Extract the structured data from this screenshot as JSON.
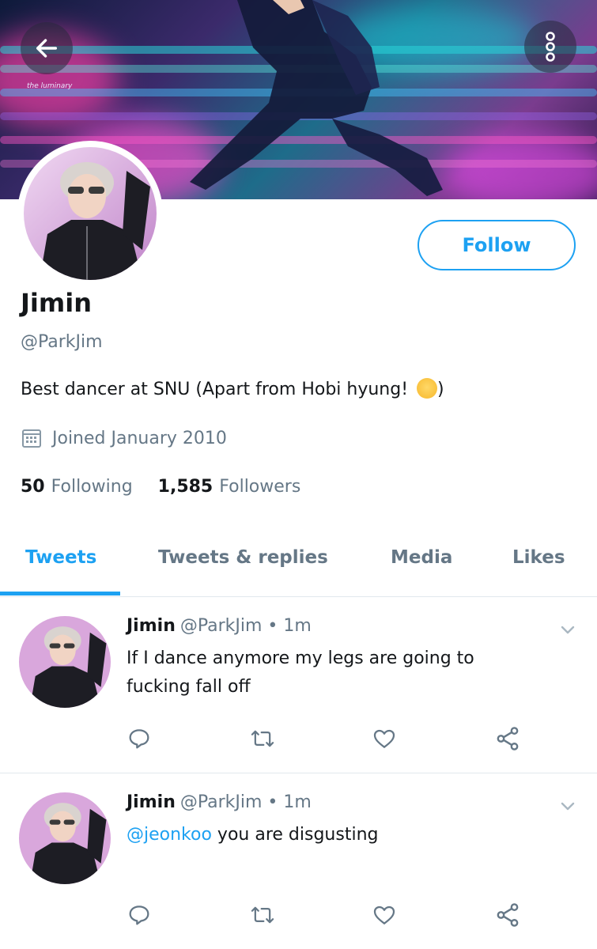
{
  "header": {
    "banner_credit": "the luminary",
    "back_icon": "arrow-left-icon",
    "more_icon": "more-vertical-icon"
  },
  "profile": {
    "name": "Jimin",
    "handle": "@ParkJim",
    "bio": "Best dancer at SNU (Apart from Hobi hyung! ",
    "bio_end": ")",
    "joined": "Joined January 2010",
    "following_count": "50",
    "following_label": "Following",
    "followers_count": "1,585",
    "followers_label": "Followers",
    "follow_label": "Follow"
  },
  "tabs": [
    {
      "label": "Tweets",
      "active": true
    },
    {
      "label": "Tweets & replies",
      "active": false
    },
    {
      "label": "Media",
      "active": false
    },
    {
      "label": "Likes",
      "active": false
    }
  ],
  "tweets": [
    {
      "name": "Jimin",
      "meta": "@ParkJim • 1m",
      "text": "If I dance anymore my legs are going to fucking fall off"
    },
    {
      "name": "Jimin",
      "meta": "@ParkJim • 1m",
      "mention": "@jeonkoo",
      "text": " you are disgusting"
    }
  ],
  "colors": {
    "accent": "#1da1f2",
    "secondary_text": "#657786",
    "primary_text": "#14171a",
    "divider": "#e1e8ed"
  }
}
